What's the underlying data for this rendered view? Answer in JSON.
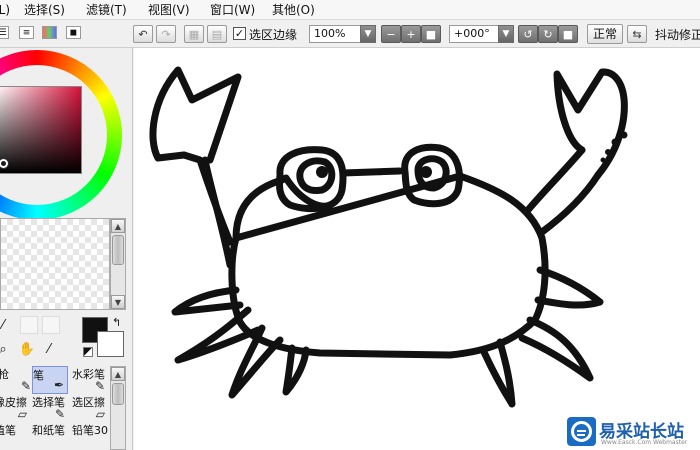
{
  "menu": {
    "items": [
      "(L)",
      "选择(S)",
      "滤镜(T)",
      "视图(V)",
      "窗口(W)",
      "其他(O)"
    ]
  },
  "toolbar": {
    "selection_edge_checked": true,
    "selection_edge_label": "选区边缘",
    "zoom_value": "100%",
    "rotation_value": "+000°",
    "blend_mode_label": "正常",
    "stabilizer_label": "抖动修正"
  },
  "color_panel": {
    "foreground_color": "#111111",
    "background_color": "#ffffff",
    "hue_color": "#d8123c"
  },
  "brushes": [
    {
      "name": "喷枪",
      "shown": "枪"
    },
    {
      "name": "笔",
      "shown": "笔",
      "selected": true
    },
    {
      "name": "水彩笔",
      "shown": "水彩笔"
    },
    {
      "name": "橡皮擦",
      "shown": "橡皮擦"
    },
    {
      "name": "选择笔",
      "shown": "选择笔"
    },
    {
      "name": "选区擦",
      "shown": "选区擦"
    },
    {
      "name": "马克笔",
      "shown": "值笔"
    },
    {
      "name": "和纸笔",
      "shown": "和纸笔"
    },
    {
      "name": "铅笔30",
      "shown": "铅笔30"
    }
  ],
  "watermark": {
    "text": "易采站长站",
    "subtext": "Www.Easck.Com Webmaster",
    "logo_color": "#1a6bc4"
  },
  "icons": {
    "undo": "undo-icon",
    "redo": "redo-icon",
    "rotate_left": "rotate-left-icon",
    "rotate_right": "rotate-right-icon",
    "flip": "flip-horizontal-icon"
  }
}
